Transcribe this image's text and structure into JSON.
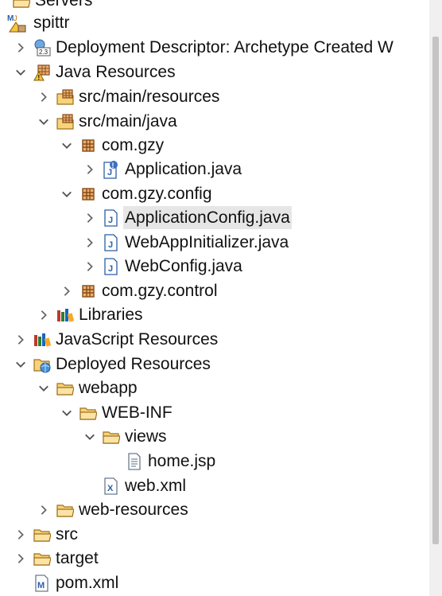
{
  "tree": {
    "servers": "Servers",
    "spittr": "spittr",
    "deployment_descriptor": "Deployment Descriptor: Archetype Created W",
    "java_resources": "Java Resources",
    "src_main_resources": "src/main/resources",
    "src_main_java": "src/main/java",
    "com_gzy": "com.gzy",
    "application_java": "Application.java",
    "com_gzy_config": "com.gzy.config",
    "application_config_java": "ApplicationConfig.java",
    "web_app_initializer_java": "WebAppInitializer.java",
    "web_config_java": "WebConfig.java",
    "com_gzy_control": "com.gzy.control",
    "libraries": "Libraries",
    "javascript_resources": "JavaScript Resources",
    "deployed_resources": "Deployed Resources",
    "webapp": "webapp",
    "web_inf": "WEB-INF",
    "views": "views",
    "home_jsp": "home.jsp",
    "web_xml": "web.xml",
    "web_resources": "web-resources",
    "src": "src",
    "target": "target",
    "pom_xml": "pom.xml"
  },
  "icon_labels": {
    "descriptor_badge": "2.3",
    "java_file_letter": "J",
    "xml_file_letter": "X",
    "maven_project_badge": "M",
    "maven_pom_letter": "M"
  },
  "colors": {
    "selection": "#e6e6e6",
    "folder": "#e8a33a",
    "java_blue": "#2b5ea8"
  }
}
